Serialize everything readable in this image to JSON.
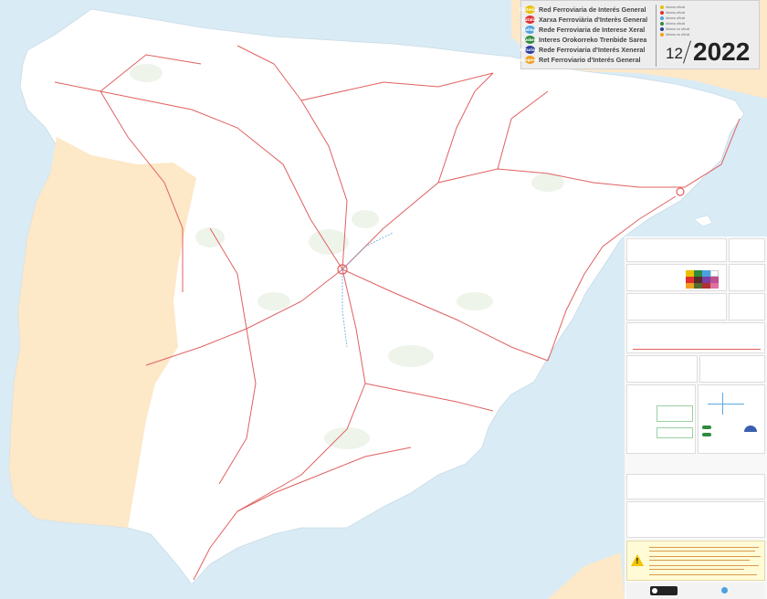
{
  "network_names": [
    {
      "badge": "Castellano",
      "text": "Red Ferroviaria de Interés General",
      "color": "#e8c000"
    },
    {
      "badge": "Catalán",
      "text": "Xarxa Ferroviària d'Interès General",
      "color": "#e03030"
    },
    {
      "badge": "Gallego",
      "text": "Rede Ferroviaria de Interese Xeral",
      "color": "#4aa3df"
    },
    {
      "badge": "Euskera",
      "text": "Interes Orokorreko Trenbide Sarea",
      "color": "#2e8b3e"
    },
    {
      "badge": "Asturiano",
      "text": "Rede Ferroviaria d'Interés Xeneral",
      "color": "#2a3f9c"
    },
    {
      "badge": "Aragonés",
      "text": "Ret Ferroviario d'Interés General",
      "color": "#f0a020"
    }
  ],
  "languages": [
    {
      "text": "Idioma oficial",
      "color": "#e8c000"
    },
    {
      "text": "Idioma oficial",
      "color": "#e03030"
    },
    {
      "text": "Idioma oficial",
      "color": "#4aa3df"
    },
    {
      "text": "Idioma oficial",
      "color": "#2e8b3e"
    },
    {
      "text": "Idioma no oficial",
      "color": "#2a3f9c"
    },
    {
      "text": "Idioma no oficial",
      "color": "#f0a020"
    }
  ],
  "date": {
    "month": "12",
    "year": "2022"
  },
  "colors": {
    "sea": "#d9ebf5",
    "land": "#ffffff",
    "portugal": "#fde8c8",
    "neighbours": "#fde8c8",
    "rail": "#e06060",
    "hsr": "#5aa7e0",
    "warning": "#fffbd6"
  },
  "icons": {
    "warning": "warning-icon",
    "license": "creative-commons-icon",
    "social": "twitter-icon"
  }
}
